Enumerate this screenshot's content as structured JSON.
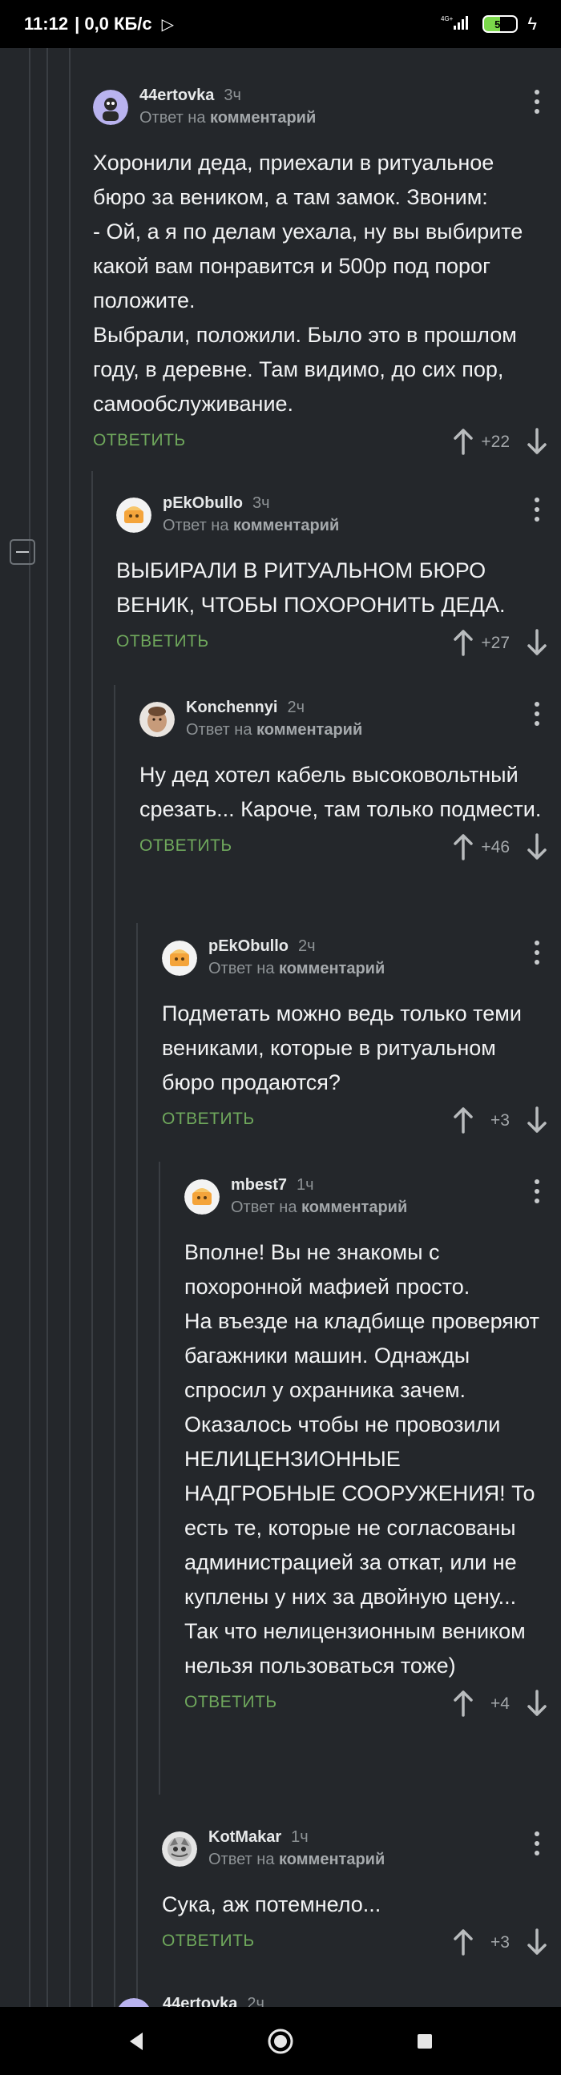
{
  "status_bar": {
    "time": "11:12",
    "speed": "| 0,0 КБ/с",
    "battery": "50",
    "network": "4G+"
  },
  "comments": [
    {
      "author": "44ertovka",
      "time": "3ч",
      "reply_prefix": "Ответ на",
      "reply_target": "комментарий",
      "text": "Хоронили деда, приехали в ритуальное бюро за веником, а там замок. Звоним:\n- Ой, а я по делам уехала, ну вы выбирите какой вам понравится и 500р под порог положите.\nВыбрали, положили. Было это в прошлом году, в деревне. Там видимо, до сих пор, самообслуживание.",
      "reply_label": "ОТВЕТИТЬ",
      "rating": "+22"
    },
    {
      "author": "pEkObullo",
      "time": "3ч",
      "reply_prefix": "Ответ на",
      "reply_target": "комментарий",
      "text": "ВЫБИРАЛИ В РИТУАЛЬНОМ БЮРО ВЕНИК, ЧТОБЫ ПОХОРОНИТЬ ДЕДА.",
      "reply_label": "ОТВЕТИТЬ",
      "rating": "+27"
    },
    {
      "author": "Konchennyi",
      "time": "2ч",
      "reply_prefix": "Ответ на",
      "reply_target": "комментарий",
      "text": "Ну дед хотел кабель высоковольтный срезать... Кароче, там только подмести.",
      "reply_label": "ОТВЕТИТЬ",
      "rating": "+46"
    },
    {
      "author": "pEkObullo",
      "time": "2ч",
      "reply_prefix": "Ответ на",
      "reply_target": "комментарий",
      "text": "Подметать можно ведь только теми вениками, которые в ритуальном бюро продаются?",
      "reply_label": "ОТВЕТИТЬ",
      "rating": "+3"
    },
    {
      "author": "mbest7",
      "time": "1ч",
      "reply_prefix": "Ответ на",
      "reply_target": "комментарий",
      "text": "Вполне! Вы не знакомы с похоронной мафией просто.\nНа въезде на кладбище проверяют багажники машин. Однажды спросил у охранника зачем. Оказалось чтобы не провозили НЕЛИЦЕНЗИОННЫЕ НАДГРОБНЫЕ СООРУЖЕНИЯ! То есть те, которые не согласованы администрацией за откат, или не куплены у них за двойную цену...\nТак что нелицензионным веником нельзя пользоваться тоже)",
      "reply_label": "ОТВЕТИТЬ",
      "rating": "+4"
    },
    {
      "author": "KotMakar",
      "time": "1ч",
      "reply_prefix": "Ответ на",
      "reply_target": "комментарий",
      "text": "Сука, аж потемнело...",
      "reply_label": "ОТВЕТИТЬ",
      "rating": "+3"
    },
    {
      "author": "44ertovka",
      "time": "2ч"
    }
  ]
}
